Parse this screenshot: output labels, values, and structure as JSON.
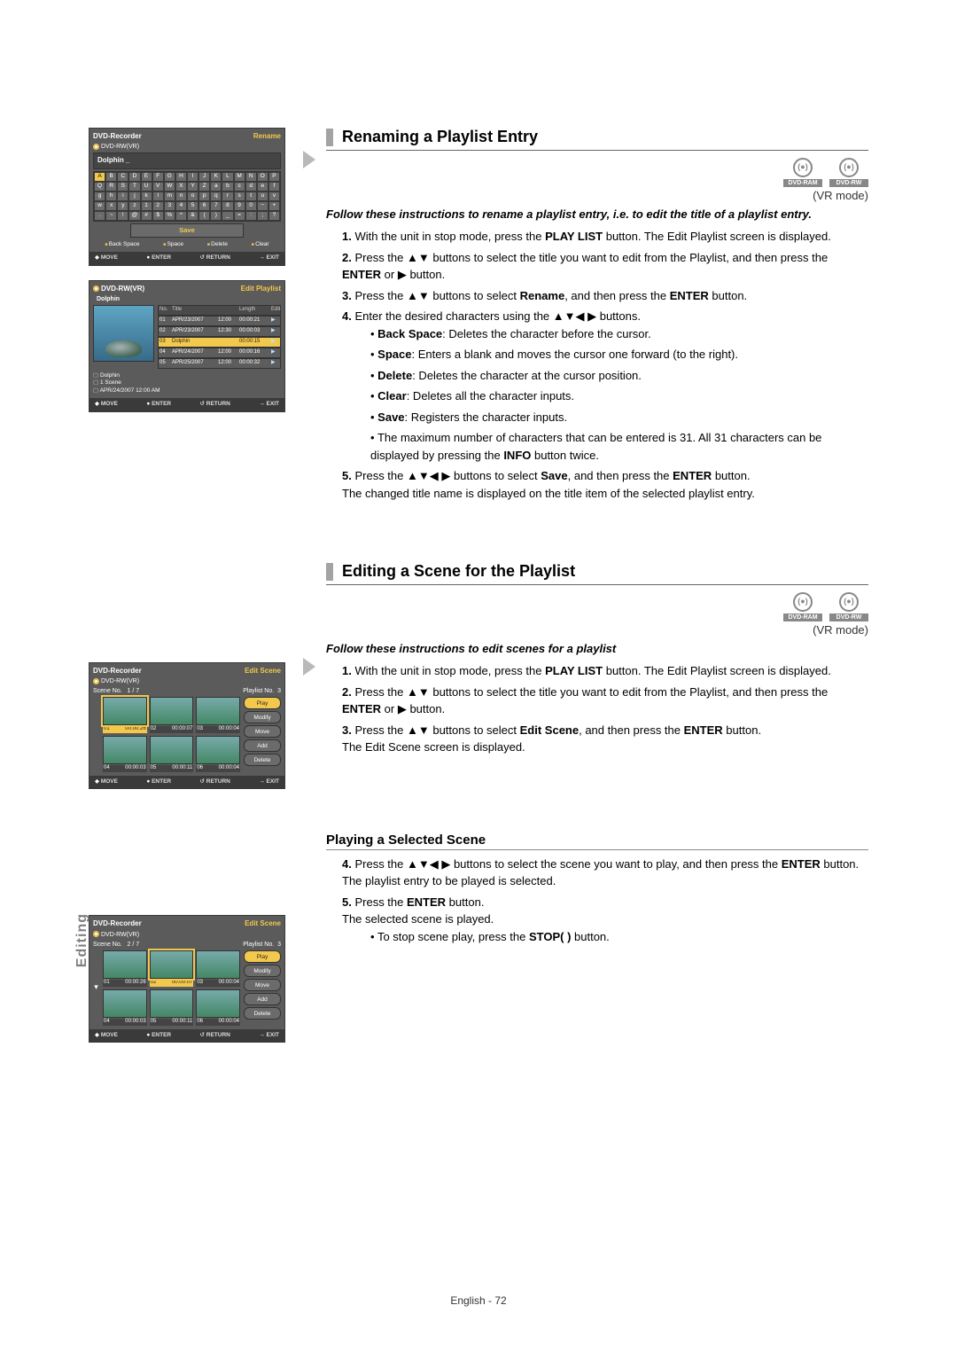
{
  "page_footer": "English - 72",
  "side_tab": "Editing",
  "section1": {
    "title": "Renaming a Playlist Entry",
    "badges": [
      "DVD-RAM",
      "DVD-RW"
    ],
    "vr_mode": "(VR mode)",
    "intro": "Follow these instructions to rename a playlist entry, i.e. to edit the title of a playlist entry.",
    "steps": {
      "s1a": "With the unit in stop mode, press the ",
      "s1b": "PLAY LIST",
      "s1c": " button. The Edit Playlist screen is displayed.",
      "s2a": "Press the ▲▼ buttons to select the title you want to edit from the Playlist, and then press the ",
      "s2b": "ENTER",
      "s2c": " or ▶ button.",
      "s3a": "Press the ▲▼ buttons to select  ",
      "s3b": "Rename",
      "s3c": ", and then press the ",
      "s3d": "ENTER",
      "s3e": " button.",
      "s4a": "Enter the desired characters using the ▲▼◀ ▶ buttons.",
      "s4b1": "Back Space",
      "s4b1t": ": Deletes the character before the cursor.",
      "s4b2": "Space",
      "s4b2t": ": Enters a blank and moves the cursor one forward (to the right).",
      "s4b3": "Delete",
      "s4b3t": ": Deletes the character at the cursor position.",
      "s4b4": "Clear",
      "s4b4t": ": Deletes all the character inputs.",
      "s4b5": "Save",
      "s4b5t": ": Registers the character inputs.",
      "s4c": "The maximum number of characters that can be entered is 31. All 31 characters can be displayed by pressing the ",
      "s4cB": "INFO",
      "s4cE": " button twice.",
      "s5a": "Press the ▲▼◀ ▶ buttons to select ",
      "s5b": "Save",
      "s5c": ", and then press the ",
      "s5d": "ENTER",
      "s5e": " button.",
      "s5f": "The changed title name is displayed on the title item of the selected playlist entry."
    }
  },
  "section2": {
    "title": "Editing a Scene for the Playlist",
    "badges": [
      "DVD-RAM",
      "DVD-RW"
    ],
    "vr_mode": "(VR mode)",
    "intro": "Follow these instructions to edit scenes for a playlist",
    "steps": {
      "s1a": "With the unit in stop mode, press the ",
      "s1b": "PLAY LIST",
      "s1c": " button. The Edit Playlist screen is displayed.",
      "s2a": "Press the ▲▼ buttons to select the title you want to edit from the Playlist, and then press the ",
      "s2b": "ENTER",
      "s2c": " or ▶ button.",
      "s3a": "Press the ▲▼ buttons to select ",
      "s3b": "Edit Scene",
      "s3c": ", and then press the ",
      "s3d": "ENTER",
      "s3e": " button.",
      "s3f": "The Edit Scene screen is displayed."
    },
    "subhead": "Playing a Selected Scene",
    "sub_steps": {
      "s4a": "Press the ▲▼◀ ▶ buttons to select the scene you want to play, and then press the ",
      "s4b": "ENTER",
      "s4c": " button.",
      "s4d": "The playlist entry to be played is selected.",
      "s5a": "Press the ",
      "s5b": "ENTER",
      "s5c": " button.",
      "s5d": "The selected scene is played.",
      "s5e": "To stop scene play, press the ",
      "s5f": "STOP(  )",
      "s5g": " button."
    }
  },
  "osd_footer": {
    "move": "MOVE",
    "enter": "ENTER",
    "return": "RETURN",
    "exit": "EXIT"
  },
  "osd1": {
    "title": "DVD-Recorder",
    "mode_label": "Rename",
    "disc_label": "DVD-RW(VR)",
    "name": "Dolphin _",
    "keys": [
      "A",
      "B",
      "C",
      "D",
      "E",
      "F",
      "G",
      "H",
      "I",
      "J",
      "K",
      "L",
      "M",
      "N",
      "O",
      "P",
      "Q",
      "R",
      "S",
      "T",
      "U",
      "V",
      "W",
      "X",
      "Y",
      "Z",
      "a",
      "b",
      "c",
      "d",
      "e",
      "f",
      "g",
      "h",
      "i",
      "j",
      "k",
      "l",
      "m",
      "n",
      "o",
      "p",
      "q",
      "r",
      "s",
      "t",
      "u",
      "v",
      "w",
      "x",
      "y",
      "z",
      "1",
      "2",
      "3",
      "4",
      "5",
      "6",
      "7",
      "8",
      "9",
      "0",
      "−",
      "+",
      ".",
      "~",
      "!",
      "@",
      "#",
      "$",
      "%",
      "^",
      "&",
      "(",
      ")",
      "_",
      "=",
      ":",
      ";",
      "?"
    ],
    "save": "Save",
    "fns": [
      "Back Space",
      "Space",
      "Delete",
      "Clear"
    ]
  },
  "osd2": {
    "title": "DVD-RW(VR)",
    "mode_label": "Edit Playlist",
    "name": "Dolphin",
    "hdr": [
      "No.",
      "Title",
      "",
      "Length",
      "Edit"
    ],
    "rows": [
      [
        "01",
        "APR/23/2007",
        "12:00",
        "00:00:21",
        "▶"
      ],
      [
        "02",
        "APR/23/2007",
        "12:30",
        "00:00:03",
        "▶"
      ],
      [
        "03",
        "Dolphin",
        "",
        "00:00:15",
        "▶"
      ],
      [
        "04",
        "APR/24/2007",
        "12:00",
        "00:00:16",
        "▶"
      ],
      [
        "05",
        "APR/25/2007",
        "12:00",
        "00:00:32",
        "▶"
      ]
    ],
    "info": [
      "Dolphin",
      "1 Scene",
      "APR/24/2007 12:00 AM"
    ]
  },
  "scene_buttons": [
    "Play",
    "Modify",
    "Move",
    "Add",
    "Delete"
  ],
  "osd3": {
    "title": "DVD-Recorder",
    "mode_label": "Edit Scene",
    "disc_label": "DVD-RW(VR)",
    "scene_no_label": "Scene No.",
    "scene_no": "1 / 7",
    "pl_label": "Playlist No.",
    "pl_no": "3",
    "cells": [
      {
        "n": "01",
        "t": "00:00:26"
      },
      {
        "n": "02",
        "t": "00:00:07"
      },
      {
        "n": "03",
        "t": "00:00:04"
      },
      {
        "n": "04",
        "t": "00:00:03"
      },
      {
        "n": "05",
        "t": "00:00:11"
      },
      {
        "n": "06",
        "t": "00:00:04"
      }
    ]
  },
  "osd4": {
    "title": "DVD-Recorder",
    "mode_label": "Edit Scene",
    "disc_label": "DVD-RW(VR)",
    "scene_no_label": "Scene No.",
    "scene_no": "2 / 7",
    "pl_label": "Playlist No.",
    "pl_no": "3",
    "cells": [
      {
        "n": "01",
        "t": "00:00:26"
      },
      {
        "n": "02",
        "t": "00:00:07"
      },
      {
        "n": "03",
        "t": "00:00:04"
      },
      {
        "n": "04",
        "t": "00:00:03"
      },
      {
        "n": "05",
        "t": "00:00:11"
      },
      {
        "n": "06",
        "t": "00:00:04"
      }
    ]
  }
}
